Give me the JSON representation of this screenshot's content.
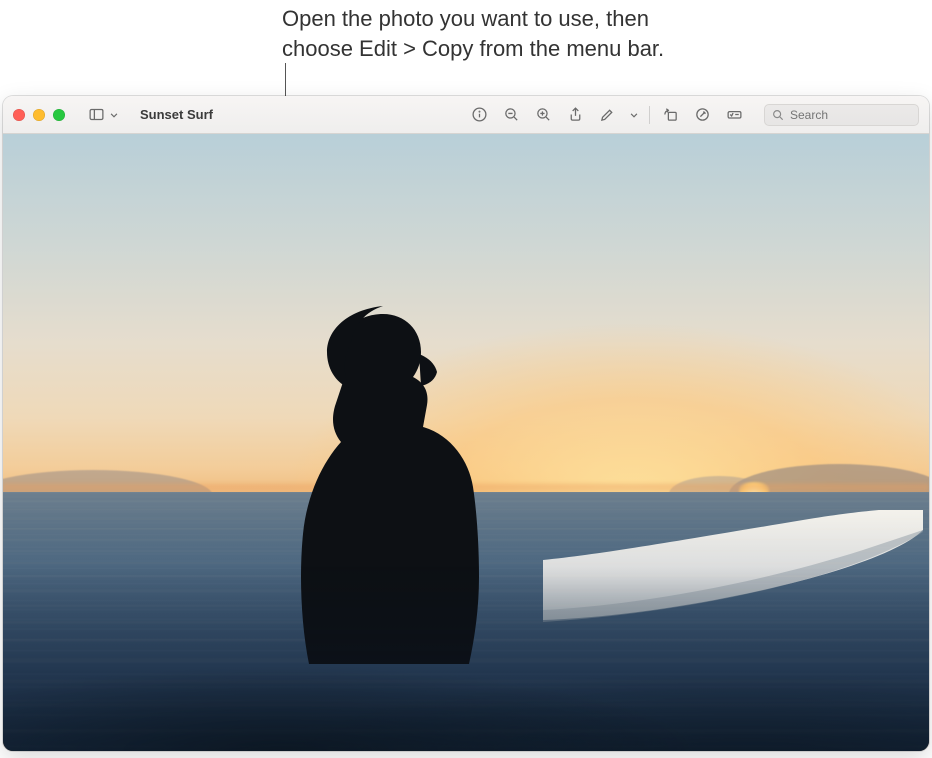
{
  "callout": {
    "line1": "Open the photo you want to use, then",
    "line2": "choose Edit > Copy from the menu bar."
  },
  "window": {
    "title": "Sunset Surf",
    "toolbar": {
      "icons": {
        "sidebar": "sidebar-icon",
        "info": "info-icon",
        "zoom_out": "zoom-out-icon",
        "zoom_in": "zoom-in-icon",
        "share": "share-icon",
        "highlight": "highlight-icon",
        "rotate": "rotate-icon",
        "markup": "markup-icon",
        "form": "form-fill-icon"
      }
    },
    "search": {
      "placeholder": "Search"
    }
  }
}
